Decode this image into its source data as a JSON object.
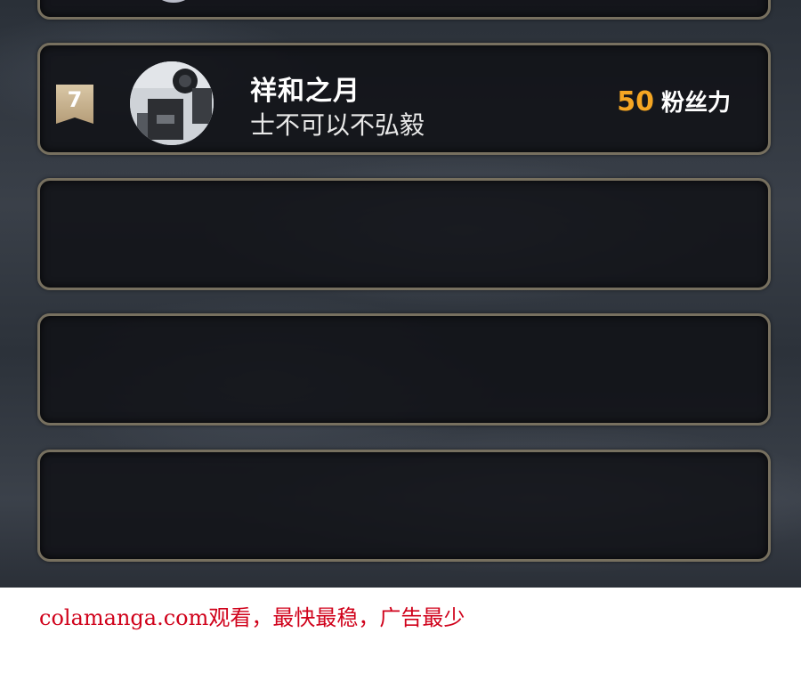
{
  "ranking_entry": {
    "rank": "7",
    "name": "祥和之月",
    "motto": "士不可以不弘毅",
    "score": "50",
    "score_unit": "粉丝力"
  },
  "watermark": {
    "text": "colamanga.com观看，最快最稳，广告最少"
  },
  "colors": {
    "score_accent": "#f5a623",
    "watermark": "#d0021b",
    "card_border": "#77705f"
  }
}
